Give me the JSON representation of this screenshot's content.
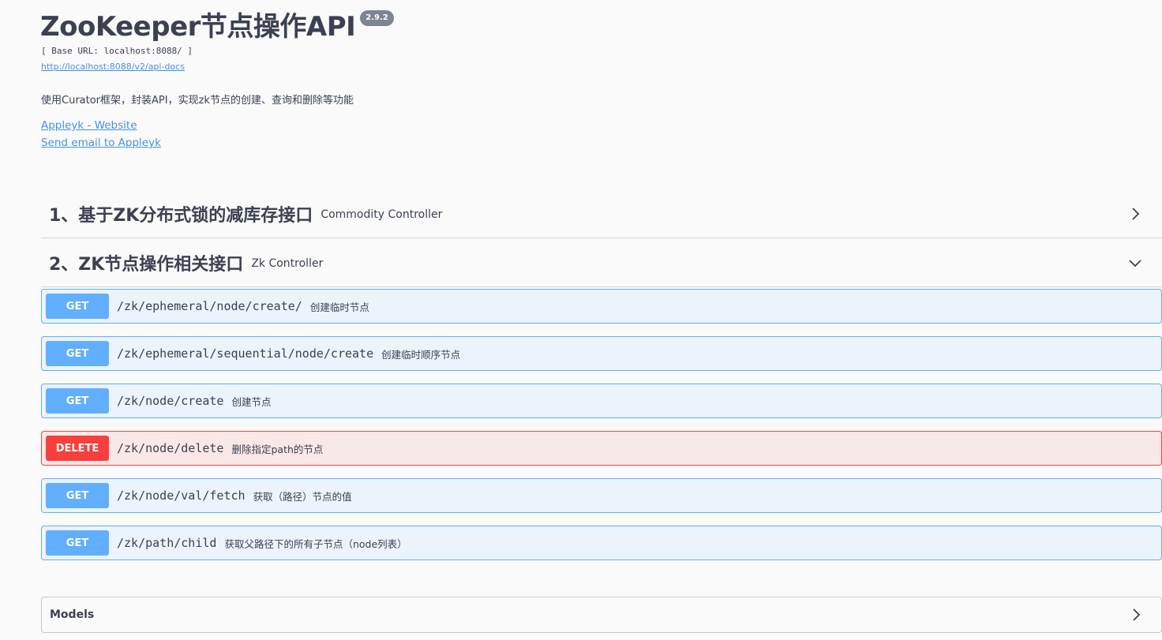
{
  "info": {
    "title": "ZooKeeper节点操作API",
    "version": "2.9.2",
    "base_url": "[ Base URL: localhost:8088/ ]",
    "docs_link": "http://localhost:8088/v2/api-docs",
    "description": "使用Curator框架，封装API，实现zk节点的创建、查询和删除等功能",
    "contact_website": "Appleyk - Website",
    "contact_email": "Send email to Appleyk"
  },
  "tags": [
    {
      "name": "1、基于ZK分布式锁的减库存接口",
      "description": "Commodity Controller",
      "expanded": false
    },
    {
      "name": "2、ZK节点操作相关接口",
      "description": "Zk Controller",
      "expanded": true
    }
  ],
  "operations": [
    {
      "method": "GET",
      "path": "/zk/ephemeral/node/create/",
      "summary": "创建临时节点"
    },
    {
      "method": "GET",
      "path": "/zk/ephemeral/sequential/node/create",
      "summary": "创建临时顺序节点"
    },
    {
      "method": "GET",
      "path": "/zk/node/create",
      "summary": "创建节点"
    },
    {
      "method": "DELETE",
      "path": "/zk/node/delete",
      "summary": "删除指定path的节点"
    },
    {
      "method": "GET",
      "path": "/zk/node/val/fetch",
      "summary": "获取（路径）节点的值"
    },
    {
      "method": "GET",
      "path": "/zk/path/child",
      "summary": "获取父路径下的所有子节点（node列表）"
    }
  ],
  "models": {
    "title": "Models"
  },
  "colors": {
    "get": "#61affe",
    "delete": "#f93e3e",
    "link": "#4990e2",
    "text": "#3b4151"
  }
}
